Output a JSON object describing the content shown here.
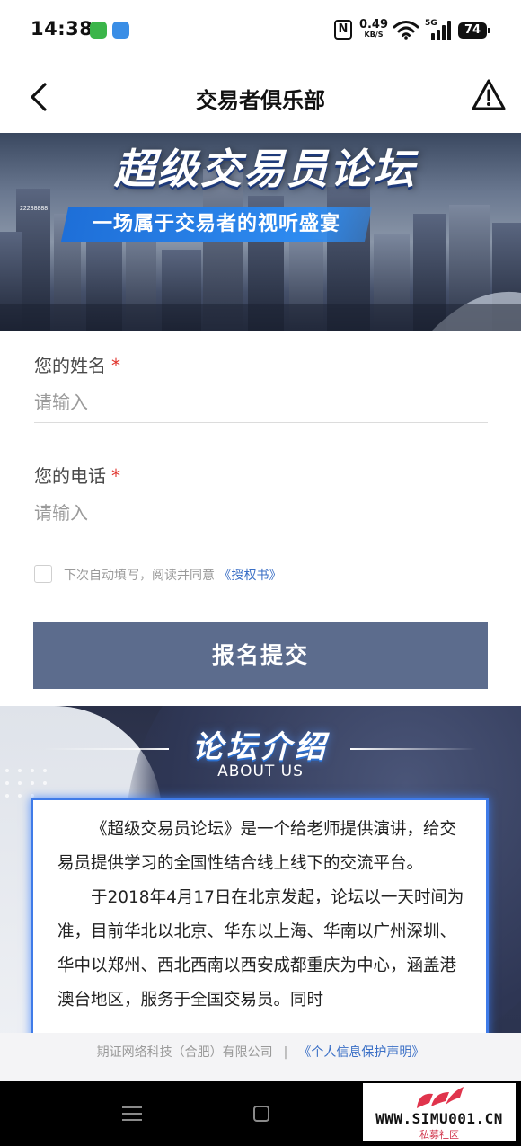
{
  "status_bar": {
    "time": "14:38",
    "net_speed": "0.49",
    "net_speed_unit": "KB/S",
    "signal": "5G",
    "battery": "74",
    "icons": [
      "messages-app-icon",
      "weather-app-icon",
      "nfc-icon",
      "wifi-icon",
      "signal-icon",
      "battery-icon"
    ]
  },
  "nav": {
    "title": "交易者俱乐部",
    "back_icon": "chevron-left-icon",
    "report_icon": "warning-icon"
  },
  "banner": {
    "title": "超级交易员论坛",
    "subtitle": "一场属于交易者的视听盛宴",
    "building_sign": "22288888"
  },
  "form": {
    "name_label": "您的姓名",
    "name_placeholder": "请输入",
    "phone_label": "您的电话",
    "phone_placeholder": "请输入",
    "required_mark": "*",
    "consent_text": "下次自动填写，阅读并同意",
    "consent_link": "《授权书》",
    "consent_checked": false,
    "submit_label": "报名提交"
  },
  "about": {
    "title": "论坛介绍",
    "subtitle": "ABOUT US",
    "paragraphs": [
      "《超级交易员论坛》是一个给老师提供演讲，给交易员提供学习的全国性结合线上线下的交流平台。",
      "于2018年4月17日在北京发起，论坛以一天时间为准，目前华北以北京、华东以上海、华南以广州深圳、华中以郑州、西北西南以西安成都重庆为中心，涵盖港澳台地区，服务于全国交易员。同时"
    ]
  },
  "footer": {
    "company": "期证网络科技（合肥）有限公司",
    "separator": "|",
    "privacy_link": "《个人信息保护声明》"
  },
  "watermark": {
    "url": "WWW.SIMU001.CN",
    "label": "私募社区"
  },
  "colors": {
    "submit_bg": "#5c6c8d",
    "link": "#3a6fc6",
    "required": "#e0342c",
    "card_border": "#3f7be8"
  }
}
